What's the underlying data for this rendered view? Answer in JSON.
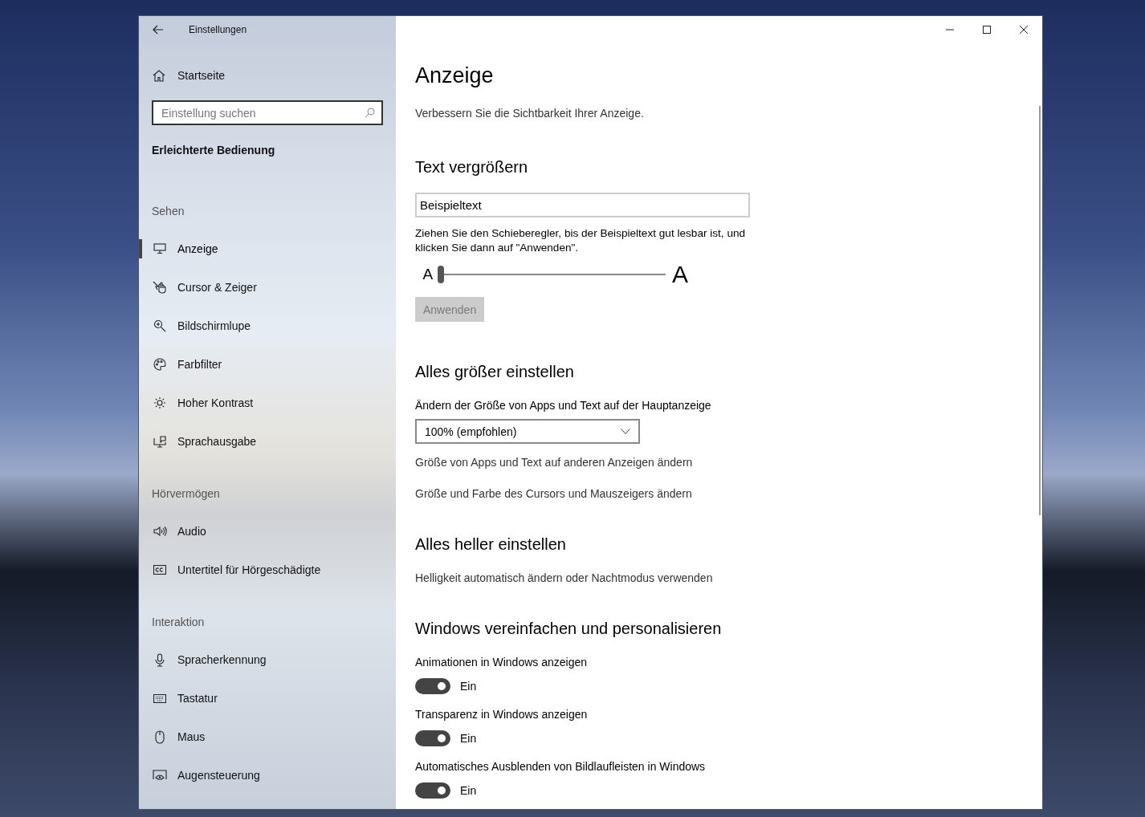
{
  "window": {
    "title": "Einstellungen"
  },
  "sidebar": {
    "home": "Startseite",
    "search": {
      "placeholder": "Einstellung suchen"
    },
    "category": "Erleichterte Bedienung",
    "groups": [
      {
        "heading": "Sehen",
        "items": [
          {
            "label": "Anzeige",
            "selected": true
          },
          {
            "label": "Cursor & Zeiger",
            "selected": false
          },
          {
            "label": "Bildschirmlupe",
            "selected": false
          },
          {
            "label": "Farbfilter",
            "selected": false
          },
          {
            "label": "Hoher Kontrast",
            "selected": false
          },
          {
            "label": "Sprachausgabe",
            "selected": false
          }
        ]
      },
      {
        "heading": "Hörvermögen",
        "items": [
          {
            "label": "Audio",
            "selected": false
          },
          {
            "label": "Untertitel für Hörgeschädigte",
            "selected": false
          }
        ]
      },
      {
        "heading": "Interaktion",
        "items": [
          {
            "label": "Spracherkennung",
            "selected": false
          },
          {
            "label": "Tastatur",
            "selected": false
          },
          {
            "label": "Maus",
            "selected": false
          },
          {
            "label": "Augensteuerung",
            "selected": false
          }
        ]
      }
    ]
  },
  "page": {
    "title": "Anzeige",
    "subtitle": "Verbessern Sie die Sichtbarkeit Ihrer Anzeige.",
    "sections": [
      {
        "kind": "text_size",
        "heading": "Text vergrößern",
        "sample": "Beispieltext",
        "hint": "Ziehen Sie den Schieberegler, bis der Beispieltext gut lesbar ist, und klicken Sie dann auf \"Anwenden\".",
        "slider": {
          "min_label": "A",
          "max_label": "A",
          "level": 0
        },
        "apply_button": {
          "label": "Anwenden",
          "disabled": true
        }
      },
      {
        "kind": "scale",
        "heading": "Alles größer einstellen",
        "label": "Ändern der Größe von Apps und Text auf der Hauptanzeige",
        "dropdown": "100% (empfohlen)",
        "links": [
          "Größe von Apps und Text auf anderen Anzeigen ändern",
          "Größe und Farbe des Cursors und Mauszeigers ändern"
        ]
      },
      {
        "kind": "brightness",
        "heading": "Alles heller einstellen",
        "links": [
          "Helligkeit automatisch ändern oder Nachtmodus verwenden"
        ]
      },
      {
        "kind": "simplify",
        "heading": "Windows vereinfachen und personalisieren",
        "toggles": [
          {
            "label": "Animationen in Windows anzeigen",
            "on": true,
            "state_text": "Ein"
          },
          {
            "label": "Transparenz in Windows anzeigen",
            "on": true,
            "state_text": "Ein"
          },
          {
            "label": "Automatisches Ausblenden von Bildlaufleisten in Windows",
            "on": true,
            "state_text": "Ein"
          }
        ]
      }
    ]
  }
}
